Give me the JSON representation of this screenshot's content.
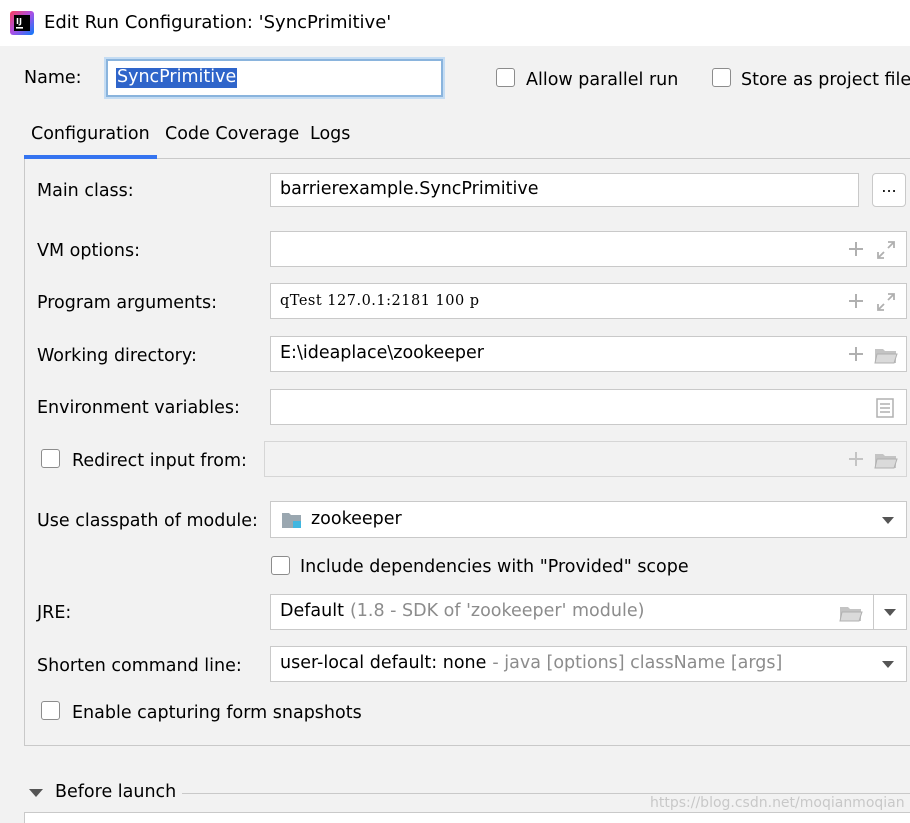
{
  "window": {
    "title": "Edit Run Configuration: 'SyncPrimitive'",
    "icon": "intellij-app-icon"
  },
  "header": {
    "name_label": "Name:",
    "name_value": "SyncPrimitive",
    "allow_parallel_label": "Allow parallel run",
    "store_project_label": "Store as project file",
    "allow_parallel_checked": false,
    "store_project_checked": false
  },
  "tabs": [
    {
      "label": "Configuration",
      "active": true
    },
    {
      "label": "Code Coverage",
      "active": false
    },
    {
      "label": "Logs",
      "active": false
    }
  ],
  "form": {
    "main_class": {
      "label": "Main class:",
      "value": "barrierexample.SyncPrimitive",
      "button": "..."
    },
    "vm_options": {
      "label": "VM options:",
      "value": ""
    },
    "program_args": {
      "label": "Program arguments:",
      "value": "qTest 127.0.1:2181 100 p"
    },
    "working_dir": {
      "label": "Working directory:",
      "value": "E:\\ideaplace\\zookeeper"
    },
    "env_vars": {
      "label": "Environment variables:",
      "value": ""
    },
    "redirect_input": {
      "label": "Redirect input from:",
      "checked": false,
      "value": ""
    },
    "classpath_module": {
      "label": "Use classpath of module:",
      "value": "zookeeper"
    },
    "include_provided": {
      "label": "Include dependencies with \"Provided\" scope",
      "checked": false
    },
    "jre": {
      "label": "JRE:",
      "value": "Default",
      "hint": "(1.8 - SDK of 'zookeeper' module)"
    },
    "shorten_cmd": {
      "label": "Shorten command line:",
      "value": "user-local default: none",
      "hint": "- java [options] className [args]"
    },
    "form_snapshots": {
      "label": "Enable capturing form snapshots",
      "checked": false
    }
  },
  "before_launch": {
    "label": "Before launch"
  },
  "watermark": "https://blog.csdn.net/moqianmoqian",
  "colors": {
    "accent": "#3574f0",
    "selection": "#2f65ca",
    "focus_border": "#8ab4dd"
  }
}
